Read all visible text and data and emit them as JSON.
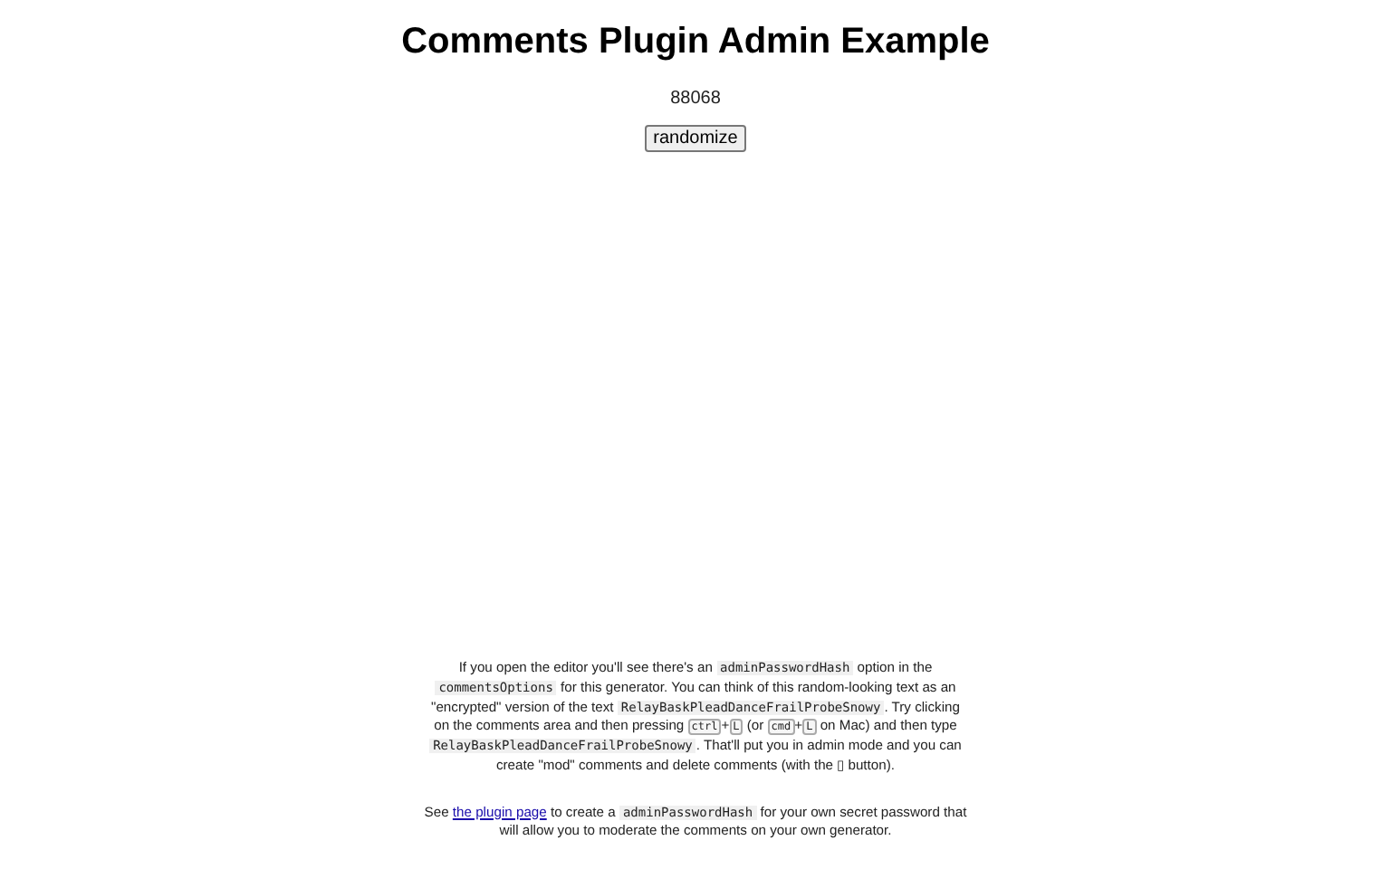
{
  "title": "Comments Plugin Admin Example",
  "number": "88068",
  "button": "randomize",
  "paragraphs": [
    {
      "segments": [
        {
          "kind": "text",
          "text": "If you open the editor you'll see there's an "
        },
        {
          "kind": "code",
          "text": "adminPasswordHash"
        },
        {
          "kind": "text",
          "text": " option in the "
        },
        {
          "kind": "code",
          "text": "commentsOptions"
        },
        {
          "kind": "text",
          "text": " for this generator. You can think of this random-looking text as an \"encrypted\" version of the text "
        },
        {
          "kind": "code",
          "text": "RelayBaskPleadDanceFrailProbeSnowy"
        },
        {
          "kind": "text",
          "text": ". Try clicking on the comments area and then pressing "
        },
        {
          "kind": "kbd",
          "text": "ctrl"
        },
        {
          "kind": "text",
          "text": "+"
        },
        {
          "kind": "kbd",
          "text": "L"
        },
        {
          "kind": "text",
          "text": " (or "
        },
        {
          "kind": "kbd",
          "text": "cmd"
        },
        {
          "kind": "text",
          "text": "+"
        },
        {
          "kind": "kbd",
          "text": "L"
        },
        {
          "kind": "text",
          "text": " on Mac) and then type "
        },
        {
          "kind": "code",
          "text": "RelayBaskPleadDanceFrailProbeSnowy"
        },
        {
          "kind": "text",
          "text": ". That'll put you in admin mode and you can create \"mod\" comments and delete comments (with the ▯ button)."
        }
      ]
    },
    {
      "segments": [
        {
          "kind": "text",
          "text": "See "
        },
        {
          "kind": "link",
          "text": "the plugin page"
        },
        {
          "kind": "text",
          "text": " to create a "
        },
        {
          "kind": "code",
          "text": "adminPasswordHash"
        },
        {
          "kind": "text",
          "text": " for your own secret password that will allow you to moderate the comments on your own generator."
        }
      ]
    }
  ]
}
